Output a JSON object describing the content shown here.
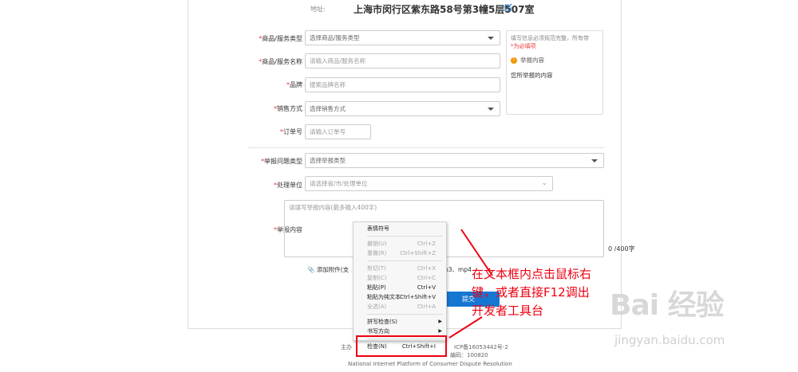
{
  "address": {
    "label": "地址:",
    "value": "上海市闵行区紫东路58号第3幢5层507室"
  },
  "form": {
    "goods_type": {
      "label": "商品/服务类型",
      "placeholder": "选择商品/服务类型"
    },
    "goods_name": {
      "label": "商品/服务名称",
      "placeholder": "请输入商品/服务名称"
    },
    "brand": {
      "label": "品牌",
      "placeholder": "搜索品牌名称"
    },
    "sale_method": {
      "label": "销售方式",
      "placeholder": "选择销售方式"
    },
    "order_no": {
      "label": "订单号",
      "placeholder": "请输入订单号"
    },
    "report_type": {
      "label": "举报问题类型",
      "placeholder": "选择举报类型"
    },
    "handler": {
      "label": "处理单位",
      "placeholder": "请选择省/市/处理单位"
    },
    "content": {
      "label": "举报内容",
      "placeholder": "请填写举报内容(最多输入400字)",
      "counter": "0  /400字"
    },
    "required_mark": "*"
  },
  "help": {
    "line1": "填写信息必须规范完整，所有带",
    "star_text": "*为必填项",
    "warn_title": "举报内容",
    "content": "您所举报的内容"
  },
  "attachment": {
    "label": "添加附件(支",
    "rest": "p3、mp4"
  },
  "submit_label": "提交",
  "footer": {
    "host": "主办",
    "icp": "ICP备16053442号-2",
    "code": "编码：100820",
    "english": "National Internet Platform of Consumer Dispute Resolution"
  },
  "context_menu": {
    "items": [
      {
        "label": "表情符号",
        "shortcut": "",
        "disabled": false
      },
      {
        "sep": true
      },
      {
        "label": "撤销(U)",
        "shortcut": "Ctrl+Z",
        "disabled": true
      },
      {
        "label": "重做(R)",
        "shortcut": "Ctrl+Shift+Z",
        "disabled": true
      },
      {
        "sep": true
      },
      {
        "label": "剪切(T)",
        "shortcut": "Ctrl+X",
        "disabled": true
      },
      {
        "label": "复制(C)",
        "shortcut": "Ctrl+C",
        "disabled": true
      },
      {
        "label": "粘贴(P)",
        "shortcut": "Ctrl+V",
        "disabled": false
      },
      {
        "label": "粘贴为纯文本",
        "shortcut": "Ctrl+Shift+V",
        "disabled": false
      },
      {
        "label": "全选(A)",
        "shortcut": "Ctrl+A",
        "disabled": true
      },
      {
        "sep": true
      },
      {
        "label": "拼写检查(S)",
        "shortcut": "",
        "disabled": false,
        "submenu": true
      },
      {
        "label": "书写方向",
        "shortcut": "",
        "disabled": false,
        "submenu": true
      },
      {
        "sep": true
      },
      {
        "label": "检查(N)",
        "shortcut": "Ctrl+Shift+I",
        "disabled": false
      }
    ]
  },
  "annotation": {
    "line1": "在文本框内点击鼠标右",
    "line2": "键，或者直接F12调出",
    "line3": "开发者工具台",
    "color": "#e01010"
  },
  "watermark": {
    "main": "Bai 经验",
    "url": "jingyan.baidu.com"
  }
}
